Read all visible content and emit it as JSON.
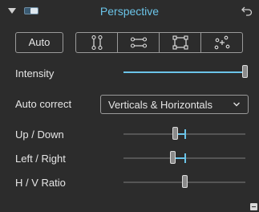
{
  "header": {
    "title": "Perspective",
    "collapse_icon": "chevron-down-icon",
    "toggle_icon": "toggle-switch-icon",
    "reset_icon": "undo-icon"
  },
  "auto_button": {
    "label": "Auto"
  },
  "modes": [
    {
      "name": "vertical-lines-icon"
    },
    {
      "name": "horizontal-lines-icon"
    },
    {
      "name": "rectangle-corners-icon"
    },
    {
      "name": "four-points-icon"
    }
  ],
  "intensity": {
    "label": "Intensity",
    "value": 1.0
  },
  "auto_correct": {
    "label": "Auto correct",
    "value": "Verticals & Horizontals"
  },
  "sliders": {
    "up_down": {
      "label": "Up / Down",
      "value": 0.42,
      "marker": 0.5
    },
    "left_right": {
      "label": "Left / Right",
      "value": 0.4,
      "marker": 0.5
    },
    "hv_ratio": {
      "label": "H / V Ratio",
      "value": 0.5
    }
  },
  "colors": {
    "accent": "#6bc4e8",
    "background": "#2c2c2c",
    "text": "#e6e6e6"
  }
}
